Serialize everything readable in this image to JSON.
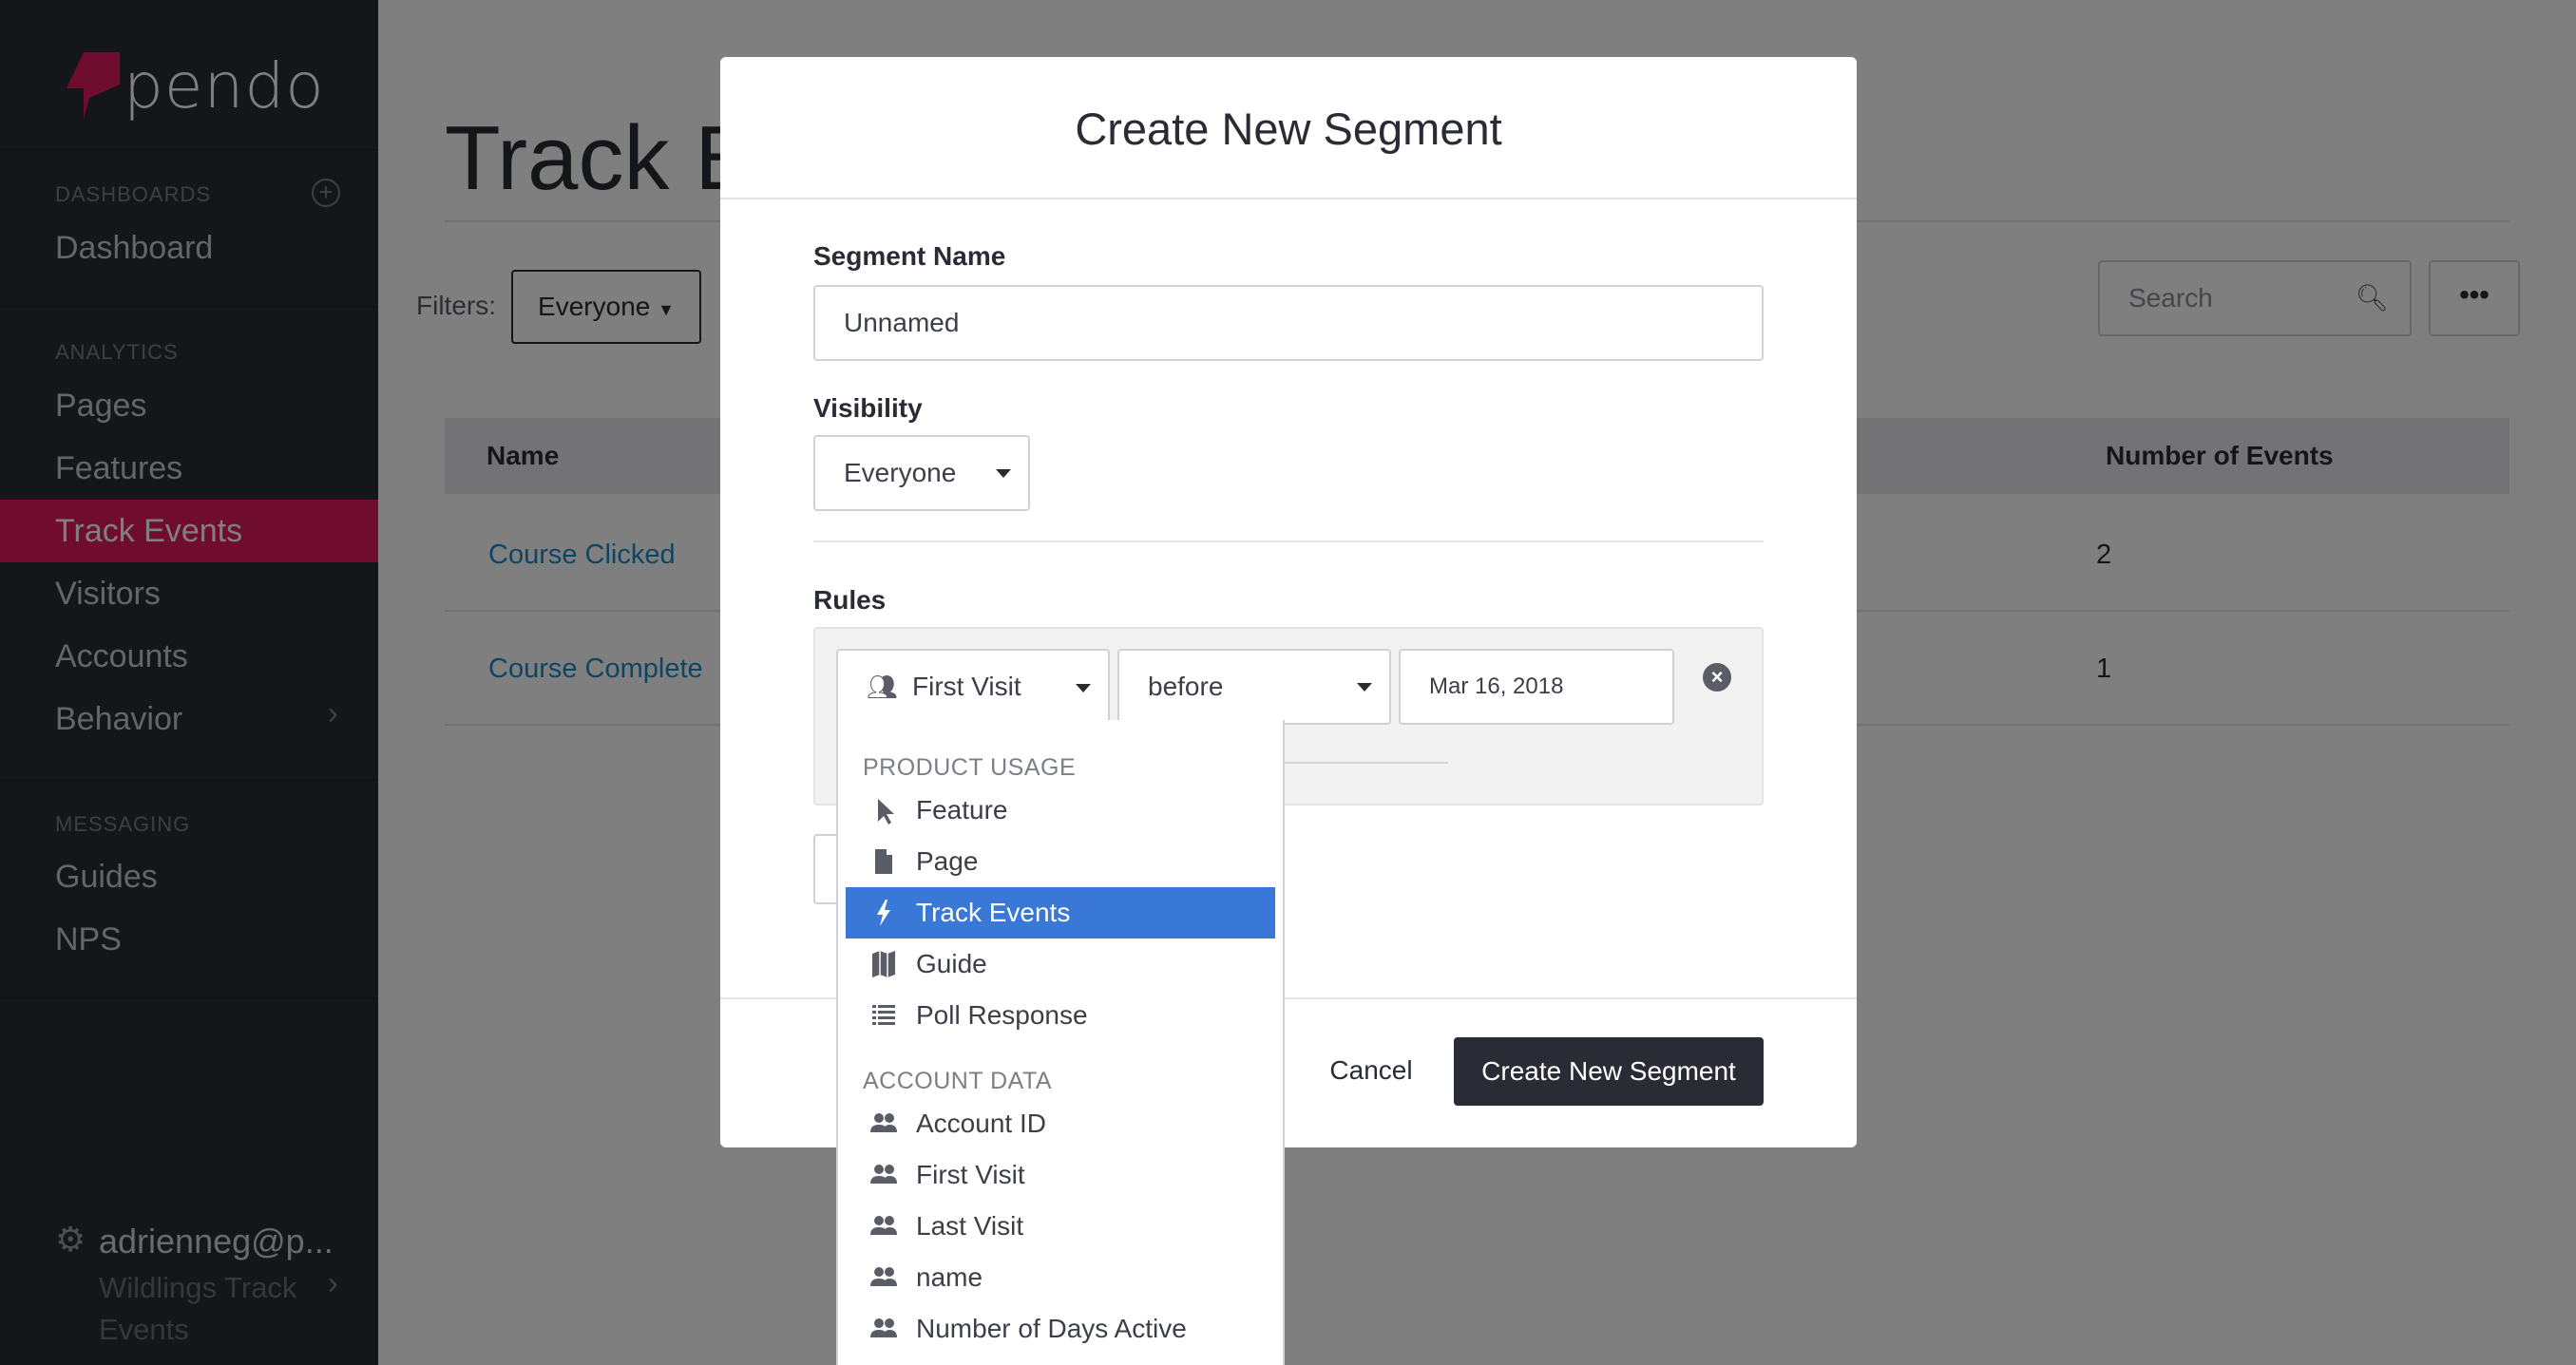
{
  "app": {
    "logo_text": "pendo",
    "brand_color": "#e0195a"
  },
  "sidebar": {
    "sections": [
      {
        "label": "DASHBOARDS",
        "items": [
          "Dashboard"
        ]
      },
      {
        "label": "ANALYTICS",
        "items": [
          "Pages",
          "Features",
          "Track Events",
          "Visitors",
          "Accounts",
          "Behavior"
        ]
      },
      {
        "label": "MESSAGING",
        "items": [
          "Guides",
          "NPS"
        ]
      }
    ],
    "active_item": "Track Events",
    "user": {
      "name": "adrienneg@p...",
      "subscription": "Wildlings Track Events"
    }
  },
  "page": {
    "title": "Track Events",
    "filters_label": "Filters:",
    "filter_value": "Everyone",
    "search_placeholder": "Search",
    "more_button": "•••",
    "table": {
      "columns": [
        "Name",
        "Number of Events"
      ],
      "rows": [
        {
          "name": "Course Clicked",
          "events": "2"
        },
        {
          "name": "Course Complete",
          "events": "1"
        }
      ]
    }
  },
  "modal": {
    "title": "Create New Segment",
    "segment_name_label": "Segment Name",
    "segment_name_value": "Unnamed",
    "visibility_label": "Visibility",
    "visibility_value": "Everyone",
    "rules_label": "Rules",
    "rule": {
      "field": "First Visit",
      "operator": "before",
      "value": "Mar 16, 2018"
    },
    "cancel_label": "Cancel",
    "create_label": "Create New Segment"
  },
  "dropdown": {
    "groups": [
      {
        "label": "PRODUCT USAGE",
        "items": [
          {
            "label": "Feature",
            "icon": "cursor-icon"
          },
          {
            "label": "Page",
            "icon": "file-icon"
          },
          {
            "label": "Track Events",
            "icon": "bolt-icon",
            "highlighted": true
          },
          {
            "label": "Guide",
            "icon": "map-icon"
          },
          {
            "label": "Poll Response",
            "icon": "list-icon"
          }
        ]
      },
      {
        "label": "ACCOUNT DATA",
        "items": [
          {
            "label": "Account ID",
            "icon": "users-icon"
          },
          {
            "label": "First Visit",
            "icon": "users-icon"
          },
          {
            "label": "Last Visit",
            "icon": "users-icon"
          },
          {
            "label": "name",
            "icon": "users-icon"
          },
          {
            "label": "Number of Days Active",
            "icon": "users-icon"
          }
        ]
      }
    ],
    "highlight_color": "#3a78d8"
  }
}
